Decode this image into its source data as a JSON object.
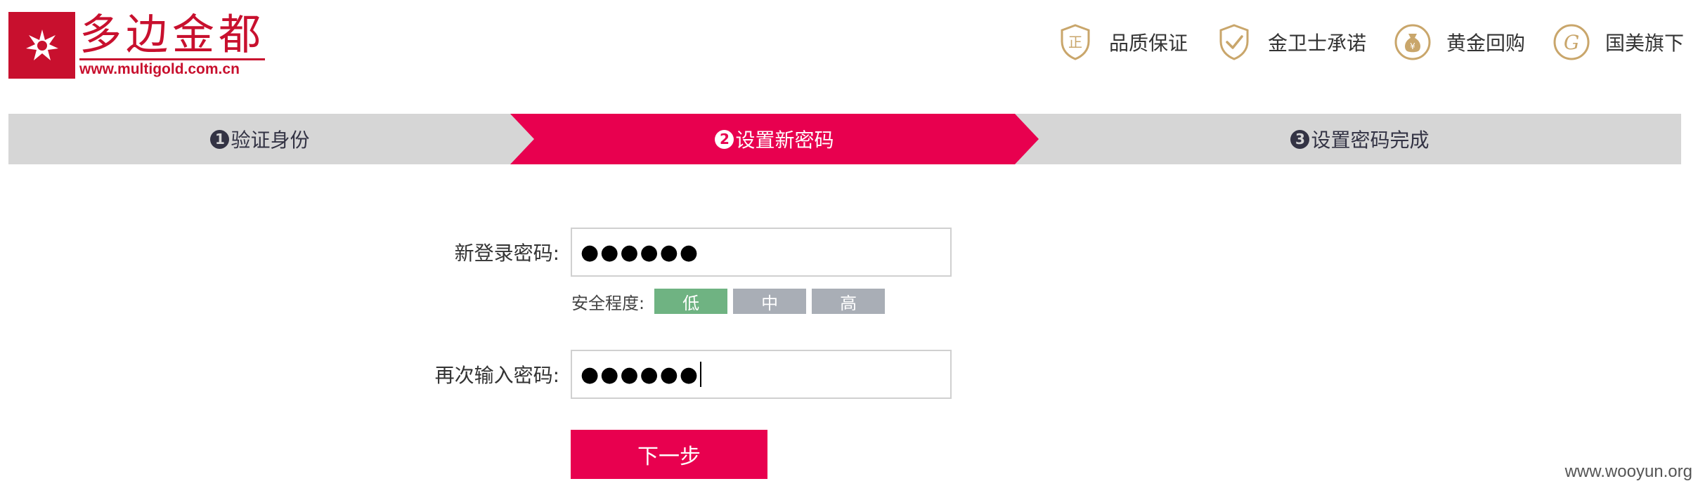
{
  "header": {
    "logo_cn": "多边金都",
    "logo_url": "www.multigold.com.cn",
    "promises": [
      {
        "icon": "shield-zheng-icon",
        "label": "品质保证"
      },
      {
        "icon": "shield-check-icon",
        "label": "金卫士承诺"
      },
      {
        "icon": "money-bag-icon",
        "label": "黄金回购"
      },
      {
        "icon": "gome-g-icon",
        "label": "国美旗下"
      }
    ]
  },
  "steps": [
    {
      "num": "1",
      "label": "验证身份",
      "state": "done"
    },
    {
      "num": "2",
      "label": "设置新密码",
      "state": "active"
    },
    {
      "num": "3",
      "label": "设置密码完成",
      "state": "pending"
    }
  ],
  "form": {
    "new_password_label": "新登录密码:",
    "new_password_value": "●●●●●●",
    "strength_label": "安全程度:",
    "strength_levels": [
      "低",
      "中",
      "高"
    ],
    "strength_current": "低",
    "confirm_password_label": "再次输入密码:",
    "confirm_password_value": "●●●●●●",
    "next_button": "下一步"
  },
  "colors": {
    "brand_red": "#c8102e",
    "accent_pink": "#e8004f",
    "gold": "#c9a66b",
    "strength_active": "#6fb382",
    "strength_inactive": "#a9aeb6",
    "step_bar_bg": "#d6d6d6"
  },
  "watermark": "www.wooyun.org"
}
